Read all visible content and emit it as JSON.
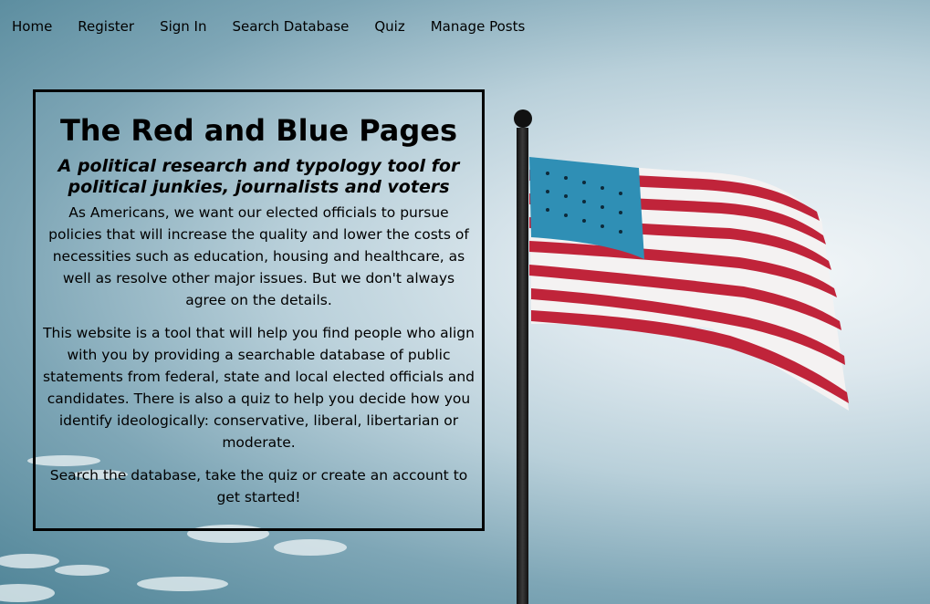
{
  "nav": {
    "items": [
      "Home",
      "Register",
      "Sign In",
      "Search Database",
      "Quiz",
      "Manage Posts"
    ]
  },
  "hero": {
    "title": "The Red and Blue Pages",
    "subtitle": "A political research and typology tool for political junkies, journalists and voters",
    "paragraphs": [
      "As Americans, we want our elected officials to pursue policies that will increase the quality and lower the costs of necessities such as education, housing and healthcare, as well as resolve other major issues. But we don't always agree on the details.",
      "This website is a tool that will help you find people who align with you by providing a searchable database of public statements from federal, state and local elected officials and candidates. There is also a quiz to help you decide how you identify ideologically: conservative, liberal, libertarian or moderate.",
      "Search the database, take the quiz or create an account to get started!"
    ]
  },
  "background": {
    "image": "american-flag-on-pole",
    "colors": {
      "sky_light": "#f2f6f8",
      "sky_dark": "#4f8497",
      "flag_red": "#c0243a",
      "flag_blue": "#2f8fb5"
    }
  }
}
